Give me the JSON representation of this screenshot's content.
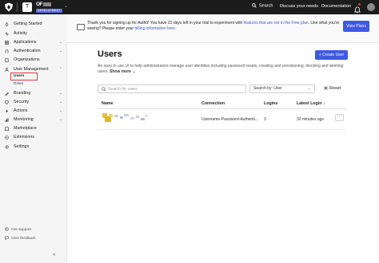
{
  "topbar": {
    "tenant_initial": "T",
    "tenant_name": "OF",
    "environment_badge": "DEVELOPMENT",
    "search_label": "Search",
    "discuss_label": "Discuss your needs",
    "docs_label": "Documentation"
  },
  "sidebar": {
    "items": [
      {
        "label": "Getting Started",
        "icon": "rocket-icon",
        "chevron": false
      },
      {
        "label": "Activity",
        "icon": "activity-icon",
        "chevron": false
      },
      {
        "label": "Applications",
        "icon": "applications-icon",
        "chevron": true
      },
      {
        "label": "Authentication",
        "icon": "authentication-icon",
        "chevron": true
      },
      {
        "label": "Organizations",
        "icon": "organizations-icon",
        "chevron": false
      },
      {
        "label": "User Management",
        "icon": "user-management-icon",
        "chevron": true
      },
      {
        "label": "Branding",
        "icon": "branding-icon",
        "chevron": true
      },
      {
        "label": "Security",
        "icon": "security-icon",
        "chevron": true
      },
      {
        "label": "Actions",
        "icon": "actions-icon",
        "chevron": true
      },
      {
        "label": "Monitoring",
        "icon": "monitoring-icon",
        "chevron": true
      },
      {
        "label": "Marketplace",
        "icon": "marketplace-icon",
        "chevron": false
      },
      {
        "label": "Extensions",
        "icon": "extensions-icon",
        "chevron": false
      },
      {
        "label": "Settings",
        "icon": "settings-icon",
        "chevron": false
      }
    ],
    "subitems": [
      "Users",
      "Roles"
    ],
    "active_subitem": "Users",
    "footer": {
      "support_label": "Get support",
      "feedback_label": "Give feedback"
    }
  },
  "banner": {
    "text_before_link": "Thank you for signing up for Auth0! You have 21 days left in your trial to experiment with ",
    "features_link": "features that are not in the Free plan",
    "text_after_link": ". Like what you're seeing? Please enter your ",
    "billing_link": "billing information here",
    "text_end": ".",
    "view_plans_label": "View Plans"
  },
  "page": {
    "title": "Users",
    "create_button": "+ Create User",
    "description": "An easy to use UI to help administrators manage user identities including password resets, creating and provisioning, blocking and deleting users.",
    "show_more": "Show more",
    "search_placeholder": "Search for users",
    "search_by_label": "Search by:",
    "search_by_value": "User",
    "reset_label": "Reset"
  },
  "table": {
    "columns": [
      "Name",
      "Connection",
      "Logins",
      "Latest Login"
    ],
    "sort_indicator": "↓",
    "rows": [
      {
        "connection": "Username-Password-Authenti...",
        "logins": "3",
        "latest_login": "32 minutes ago",
        "menu": "···"
      }
    ]
  },
  "colors": {
    "accent": "#3f59e4",
    "topbar": "#1c1c1c",
    "highlight": "#e0393e"
  }
}
